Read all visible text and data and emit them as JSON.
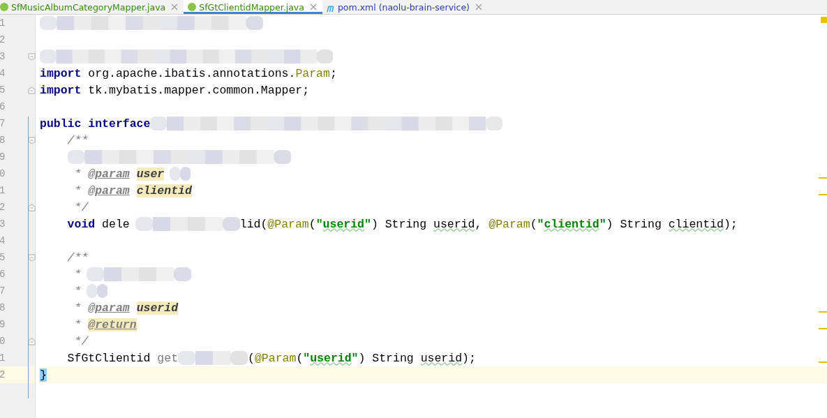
{
  "tabs": [
    {
      "kind": "interface",
      "label": "SfMusicAlbumCategoryMapper.java",
      "selected": false,
      "color": "#3a8a10"
    },
    {
      "kind": "interface",
      "label": "SfGtClientidMapper.java",
      "selected": true,
      "color": "#3a8a10"
    },
    {
      "kind": "maven",
      "label": "pom.xml (naolu-brain-service)",
      "selected": false,
      "color": "#2a3fb0"
    }
  ],
  "editor": {
    "lines": [
      {
        "number": "1",
        "current": false,
        "tokens": [
          {
            "kind": "redacted-medium"
          }
        ]
      },
      {
        "number": "2",
        "current": false
      },
      {
        "number": "3",
        "current": false,
        "fold": {
          "kind": "start"
        },
        "tokens": [
          {
            "kind": "redacted-long"
          }
        ]
      },
      {
        "number": "4",
        "current": false,
        "tokens": [
          {
            "kind": "keyword",
            "text": "import"
          },
          {
            "kind": "plain",
            "text": " org.apache.ibatis.annotations."
          },
          {
            "kind": "annotation",
            "text": "Param"
          },
          {
            "kind": "plain",
            "text": ";"
          }
        ]
      },
      {
        "number": "5",
        "current": false,
        "fold": {
          "kind": "end"
        },
        "tokens": [
          {
            "kind": "keyword",
            "text": "import"
          },
          {
            "kind": "plain",
            "text": " tk.mybatis.mapper.common.Mapper;"
          }
        ]
      },
      {
        "number": "6",
        "current": false
      },
      {
        "number": "7",
        "current": false,
        "tokens": [
          {
            "kind": "keyword",
            "text": "public interface"
          },
          {
            "kind": "redacted-wide"
          }
        ]
      },
      {
        "number": "8",
        "current": false,
        "fold": {
          "kind": "start"
        },
        "tokens": [
          {
            "kind": "comment",
            "text": "    /**"
          }
        ]
      },
      {
        "number": "9",
        "current": false,
        "tokens": [
          {
            "kind": "redacted-inner"
          }
        ]
      },
      {
        "number": "0",
        "current": false,
        "tokens": [
          {
            "kind": "comment",
            "text": "     *"
          },
          {
            "kind": "doc-tag",
            "text": "@param"
          },
          {
            "kind": "doc-param",
            "text": "user"
          },
          {
            "kind": "redacted-tiny"
          }
        ]
      },
      {
        "number": "1",
        "current": false,
        "tokens": [
          {
            "kind": "comment",
            "text": "     *"
          },
          {
            "kind": "doc-tag",
            "text": "@param"
          },
          {
            "kind": "doc-param",
            "text": "clientid"
          }
        ]
      },
      {
        "number": "2",
        "current": false,
        "fold": {
          "kind": "end"
        },
        "tokens": [
          {
            "kind": "comment",
            "text": "     */"
          }
        ]
      },
      {
        "number": "3",
        "current": false,
        "tokens": [
          {
            "kind": "keyword",
            "text": "    void"
          },
          {
            "kind": "plain",
            "text": " dele"
          },
          {
            "kind": "redacted-short"
          },
          {
            "kind": "plain",
            "text": "lid("
          },
          {
            "kind": "annotation",
            "text": "@Param"
          },
          {
            "kind": "plain",
            "text": "("
          },
          {
            "kind": "string",
            "text": "\""
          },
          {
            "kind": "string-typo",
            "text": "userid"
          },
          {
            "kind": "string",
            "text": "\""
          },
          {
            "kind": "plain",
            "text": ") String"
          },
          {
            "kind": "typo",
            "text": "userid"
          },
          {
            "kind": "plain",
            "text": ", "
          },
          {
            "kind": "annotation",
            "text": "@Param"
          },
          {
            "kind": "plain",
            "text": "("
          },
          {
            "kind": "string",
            "text": "\""
          },
          {
            "kind": "string-typo",
            "text": "clientid"
          },
          {
            "kind": "string",
            "text": "\""
          },
          {
            "kind": "plain",
            "text": ") String"
          },
          {
            "kind": "typo",
            "text": "clientid"
          },
          {
            "kind": "plain",
            "text": ");"
          }
        ]
      },
      {
        "number": "4",
        "current": false
      },
      {
        "number": "5",
        "current": false,
        "fold": {
          "kind": "start"
        },
        "tokens": [
          {
            "kind": "comment",
            "text": "    /**"
          }
        ]
      },
      {
        "number": "6",
        "current": false,
        "tokens": [
          {
            "kind": "comment",
            "text": "     *"
          },
          {
            "kind": "redacted-short"
          }
        ]
      },
      {
        "number": "7",
        "current": false,
        "tokens": [
          {
            "kind": "comment",
            "text": "     *"
          },
          {
            "kind": "redacted-tiny"
          }
        ]
      },
      {
        "number": "8",
        "current": false,
        "tokens": [
          {
            "kind": "comment",
            "text": "     *"
          },
          {
            "kind": "doc-tag",
            "text": "@param"
          },
          {
            "kind": "doc-param",
            "text": "userid"
          }
        ]
      },
      {
        "number": "9",
        "current": false,
        "tokens": [
          {
            "kind": "comment",
            "text": "     *"
          },
          {
            "kind": "doc-tag-marked",
            "text": "@return"
          }
        ]
      },
      {
        "number": "0",
        "current": false,
        "fold": {
          "kind": "end"
        },
        "tokens": [
          {
            "kind": "comment",
            "text": "     */"
          }
        ]
      },
      {
        "number": "1",
        "current": false,
        "tokens": [
          {
            "kind": "plain",
            "text": "    SfGtClientid "
          },
          {
            "kind": "dim",
            "text": "get"
          },
          {
            "kind": "redacted-small"
          },
          {
            "kind": "plain",
            "text": "("
          },
          {
            "kind": "annotation",
            "text": "@Param"
          },
          {
            "kind": "plain",
            "text": "("
          },
          {
            "kind": "string",
            "text": "\""
          },
          {
            "kind": "string-typo",
            "text": "userid"
          },
          {
            "kind": "string",
            "text": "\""
          },
          {
            "kind": "plain",
            "text": ") String"
          },
          {
            "kind": "typo",
            "text": "userid"
          },
          {
            "kind": "plain",
            "text": ");"
          }
        ]
      },
      {
        "number": "2",
        "current": true,
        "tokens": [
          {
            "kind": "brace-match",
            "text": "}"
          }
        ]
      }
    ]
  }
}
